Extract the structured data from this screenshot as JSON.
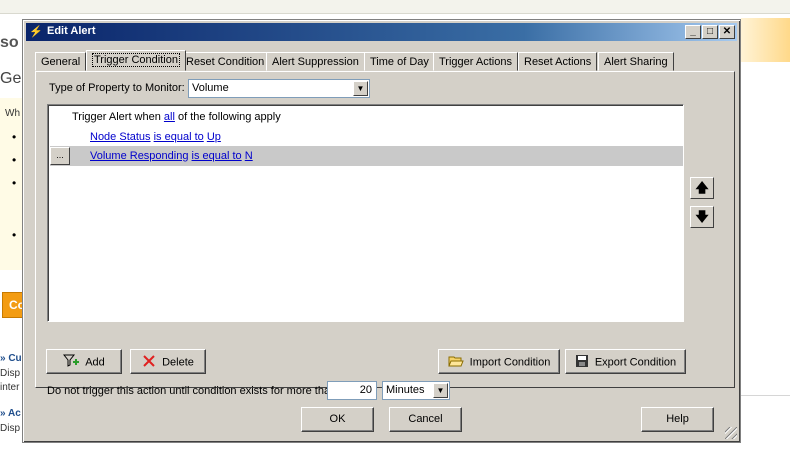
{
  "background": {
    "frag_so": "so",
    "frag_ge": "Ge",
    "frag_wh": "Wh",
    "frag_co": "Co",
    "frag_cu": "» Cu",
    "frag_disp1": "Disp",
    "frag_inter": "inter",
    "frag_ac": "» Ac",
    "frag_disp2": "Disp"
  },
  "dialog": {
    "title": "Edit Alert",
    "title_icon": "lightning-icon",
    "window_buttons": [
      "_",
      "□",
      "✕"
    ],
    "tabs": [
      {
        "label": "General"
      },
      {
        "label": "Trigger Condition"
      },
      {
        "label": "Reset Condition"
      },
      {
        "label": "Alert Suppression"
      },
      {
        "label": "Time of Day"
      },
      {
        "label": "Trigger Actions"
      },
      {
        "label": "Reset Actions"
      },
      {
        "label": "Alert Sharing"
      }
    ],
    "active_tab": "Trigger Condition",
    "property": {
      "label": "Type of Property to Monitor:",
      "value": "Volume"
    },
    "condition": {
      "prefix": "Trigger Alert when",
      "quantifier": "all",
      "suffix": "of the following apply",
      "rows": [
        {
          "field": "Node Status",
          "operator": "is equal to",
          "value": "Up"
        },
        {
          "field": "Volume Responding",
          "operator": "is equal to",
          "value": "N",
          "dots": "..."
        }
      ]
    },
    "move_up_icon": "arrow-up-icon",
    "move_down_icon": "arrow-down-icon",
    "buttons": {
      "add": "Add",
      "delete": "Delete",
      "import": "Import Condition",
      "export": "Export Condition",
      "ok": "OK",
      "cancel": "Cancel",
      "help": "Help"
    },
    "duration": {
      "label": "Do not trigger this action until condition exists for more than",
      "value": "20",
      "unit": "Minutes"
    }
  }
}
